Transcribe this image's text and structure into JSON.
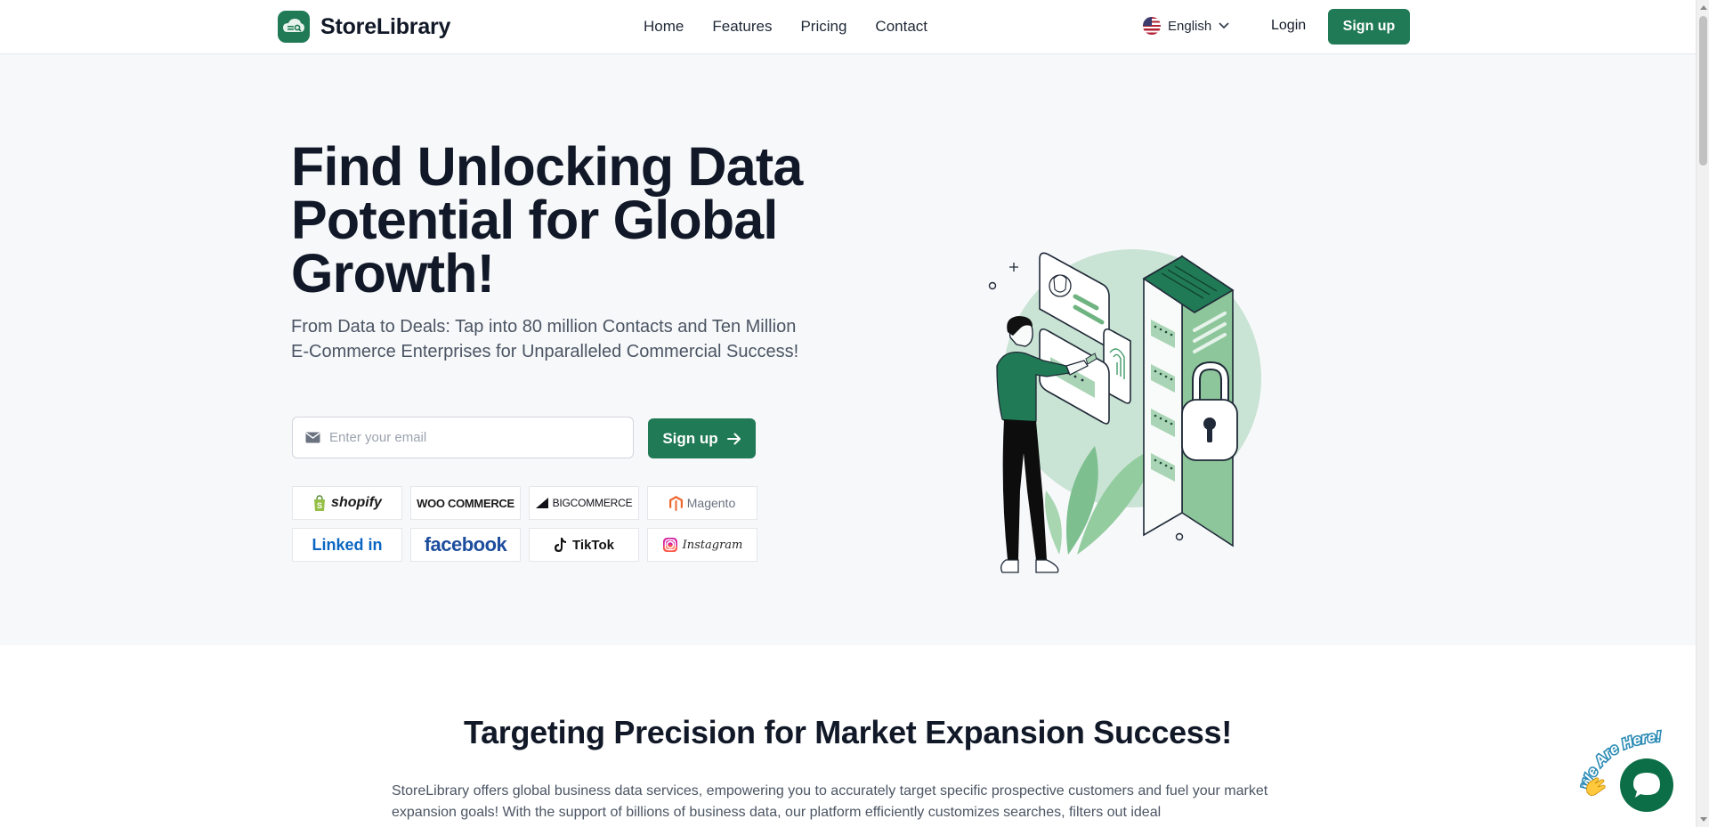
{
  "header": {
    "logo_text": "StoreLibrary",
    "nav": [
      "Home",
      "Features",
      "Pricing",
      "Contact"
    ],
    "language": "English",
    "login_label": "Login",
    "signup_label": "Sign up"
  },
  "hero": {
    "title": "Find Unlocking Data Potential for Global Growth!",
    "subtitle": "From Data to Deals: Tap into 80 million Contacts and Ten Million E-Commerce Enterprises for Unparalleled Commercial Success!",
    "email_placeholder": "Enter your email",
    "signup_label": "Sign up",
    "brands": [
      "shopify",
      "WOO COMMERCE",
      "BIGCOMMERCE",
      "Magento",
      "Linked in",
      "facebook",
      "TikTok",
      "Instagram"
    ]
  },
  "section": {
    "title": "Targeting Precision for Market Expansion Success!",
    "text": "StoreLibrary offers global business data services, empowering you to accurately target specific prospective customers and fuel your market expansion goals! With the support of billions of business data, our platform efficiently customizes searches, filters out ideal"
  },
  "chat": {
    "badge_text": "We Are Here!"
  },
  "colors": {
    "brand_green": "#207a55",
    "hero_bg": "#f7f8fa",
    "text_dark": "#111827",
    "text_muted": "#4b5563"
  },
  "icons": [
    "logo-icon",
    "us-flag-icon",
    "chevron-down-icon",
    "mail-icon",
    "arrow-right-icon",
    "chat-icon",
    "waving-hand-icon"
  ]
}
